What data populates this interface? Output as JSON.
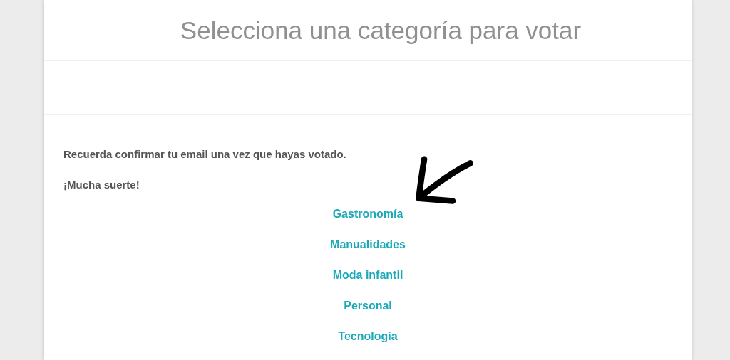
{
  "title": "Selecciona una categoría para votar",
  "paragraphs": [
    "Recuerda confirmar tu email una vez que hayas votado.",
    "¡Mucha suerte!"
  ],
  "categories": [
    "Gastronomía",
    "Manualidades",
    "Moda infantil",
    "Personal",
    "Tecnología"
  ]
}
